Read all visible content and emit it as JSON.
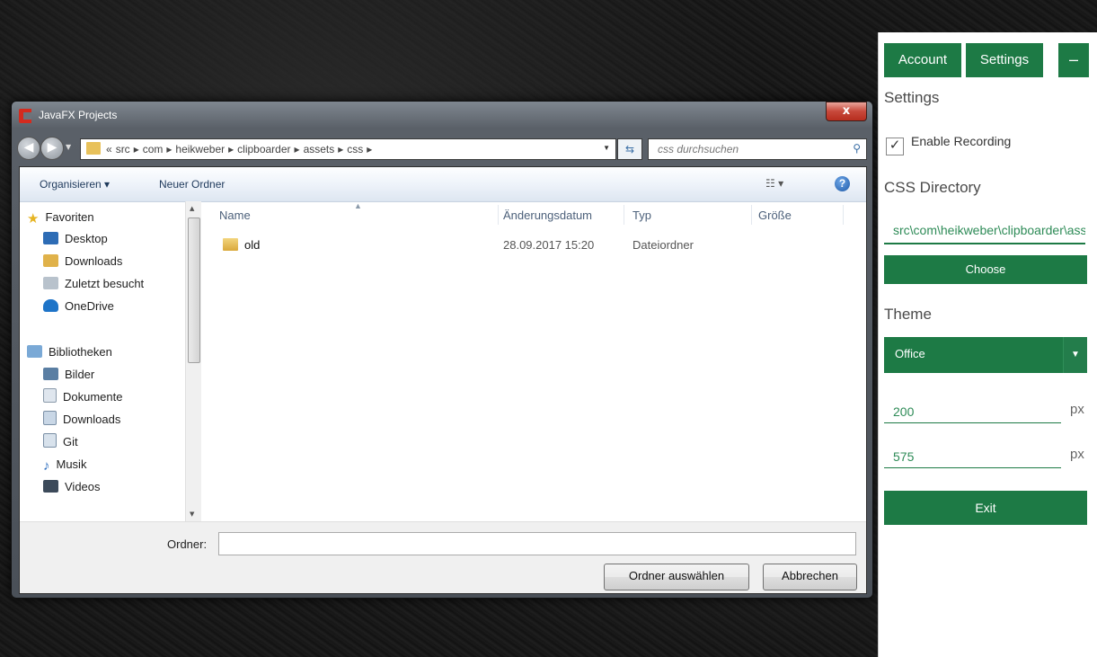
{
  "dialog": {
    "title": "JavaFX Projects",
    "close_label": "x",
    "breadcrumb": [
      "«",
      "src",
      "▸",
      "com",
      "▸",
      "heikweber",
      "▸",
      "clipboarder",
      "▸",
      "assets",
      "▸",
      "css",
      "▸"
    ],
    "search_placeholder": "css durchsuchen",
    "toolbar": {
      "organize": "Organisieren ▾",
      "new_folder": "Neuer Ordner"
    },
    "nav": {
      "favorites": "Favoriten",
      "fav_items": [
        "Desktop",
        "Downloads",
        "Zuletzt besucht",
        "OneDrive"
      ],
      "libraries": "Bibliotheken",
      "lib_items": [
        "Bilder",
        "Dokumente",
        "Downloads",
        "Git",
        "Musik",
        "Videos"
      ]
    },
    "columns": {
      "name": "Name",
      "date": "Änderungsdatum",
      "type": "Typ",
      "size": "Größe"
    },
    "files": [
      {
        "name": "old",
        "date": "28.09.2017 15:20",
        "type": "Dateiordner",
        "size": ""
      }
    ],
    "folder_label": "Ordner:",
    "folder_value": "",
    "select_button": "Ordner auswählen",
    "cancel_button": "Abbrechen"
  },
  "panel": {
    "account_button": "Account",
    "settings_button": "Settings",
    "minimize_button": "–",
    "settings_heading": "Settings",
    "enable_recording": "Enable Recording",
    "recording_checked": true,
    "css_heading": "CSS Directory",
    "css_path": "src\\com\\heikweber\\clipboarder\\assets\\css",
    "choose_button": "Choose",
    "theme_heading": "Theme",
    "theme_value": "Office",
    "width_value": "200",
    "height_value": "575",
    "unit": "px",
    "exit_button": "Exit"
  },
  "colors": {
    "accent": "#1d7a45",
    "accent_text": "#2e8b57"
  }
}
